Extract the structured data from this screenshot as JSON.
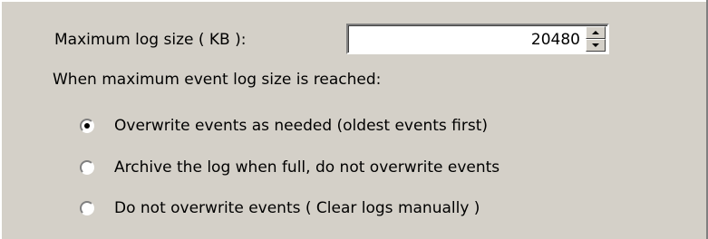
{
  "fields": {
    "max_log_label": "Maximum log size ( KB ):",
    "max_log_value": "20480",
    "when_reached_label": "When maximum event log size is reached:"
  },
  "options": [
    {
      "label": "Overwrite events as needed (oldest events first)",
      "selected": true
    },
    {
      "label": "Archive the log when full, do not overwrite events",
      "selected": false
    },
    {
      "label": "Do not overwrite events ( Clear logs manually )",
      "selected": false
    }
  ],
  "icons": {
    "up_arrow": "triangle-up-icon",
    "down_arrow": "triangle-down-icon"
  },
  "colors": {
    "background": "#d4d0c8",
    "field_background": "#ffffff",
    "text": "#000000",
    "shadow": "#808080",
    "highlight": "#ffffff"
  }
}
